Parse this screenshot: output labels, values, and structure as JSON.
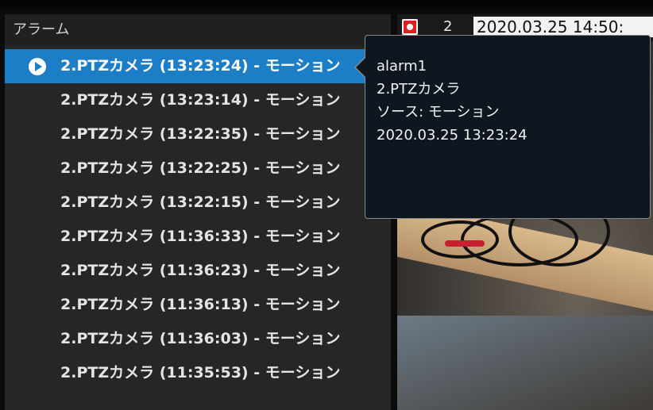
{
  "panel": {
    "title": "アラーム",
    "items": [
      {
        "label": "2.PTZカメラ (13:23:24) - モーション",
        "selected": true
      },
      {
        "label": "2.PTZカメラ (13:23:14) - モーション"
      },
      {
        "label": "2.PTZカメラ (13:22:35) - モーション"
      },
      {
        "label": "2.PTZカメラ (13:22:25) - モーション"
      },
      {
        "label": "2.PTZカメラ (13:22:15) - モーション"
      },
      {
        "label": "2.PTZカメラ (11:36:33) - モーション"
      },
      {
        "label": "2.PTZカメラ (11:36:23) - モーション"
      },
      {
        "label": "2.PTZカメラ (11:36:13) - モーション"
      },
      {
        "label": "2.PTZカメラ (11:36:03) - モーション"
      },
      {
        "label": "2.PTZカメラ (11:35:53) - モーション"
      }
    ]
  },
  "video": {
    "camera_number": "2",
    "timestamp": "2020.03.25 14:50:"
  },
  "tooltip": {
    "alarm_name": "alarm1",
    "camera": "2.PTZカメラ",
    "source": "ソース: モーション",
    "time": "2020.03.25 13:23:24"
  },
  "colors": {
    "selection": "#1d7ec8",
    "record": "#e02020"
  },
  "icons": {
    "play": "play-icon",
    "record": "record-icon"
  }
}
